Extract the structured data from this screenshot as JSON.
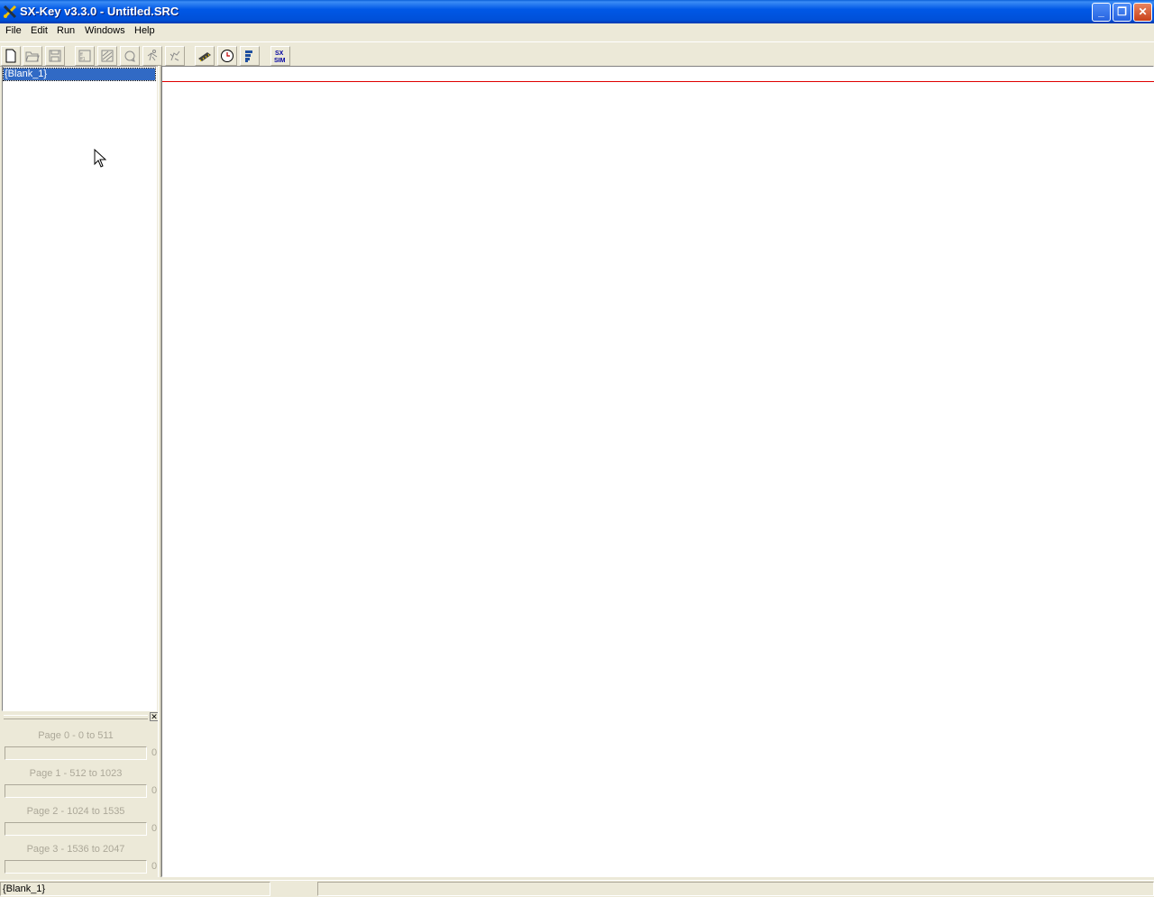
{
  "window": {
    "title": "SX-Key v3.3.0 - Untitled.SRC",
    "app_icon": "sx-key-tools-icon",
    "controls": {
      "minimize": "minimize-icon",
      "restore": "restore-icon",
      "close": "close-icon"
    }
  },
  "menubar": {
    "items": [
      {
        "label": "File"
      },
      {
        "label": "Edit"
      },
      {
        "label": "Run"
      },
      {
        "label": "Windows"
      },
      {
        "label": "Help"
      }
    ]
  },
  "toolbar": {
    "buttons": [
      {
        "name": "new-file",
        "icon": "new-document-icon"
      },
      {
        "name": "open-file",
        "icon": "open-folder-icon"
      },
      {
        "name": "save-file",
        "icon": "save-disk-icon"
      },
      {
        "name": "assemble",
        "icon": "assemble-icon"
      },
      {
        "name": "program",
        "icon": "program-icon"
      },
      {
        "name": "reset",
        "icon": "reset-icon"
      },
      {
        "name": "run",
        "icon": "run-icon"
      },
      {
        "name": "debug",
        "icon": "debug-icon"
      },
      {
        "name": "device",
        "icon": "chip-icon"
      },
      {
        "name": "clock",
        "icon": "clock-icon"
      },
      {
        "name": "list",
        "icon": "list-icon"
      },
      {
        "name": "sx-sim",
        "icon": "sx-sim-icon",
        "text": "SX SIM"
      }
    ]
  },
  "tree": {
    "selected_item": "{Blank_1}"
  },
  "memory_panel": {
    "pages": [
      {
        "label": "Page 0 - 0 to 511",
        "value": "0"
      },
      {
        "label": "Page 1 - 512 to 1023",
        "value": "0"
      },
      {
        "label": "Page 2 - 1024 to 1535",
        "value": "0"
      },
      {
        "label": "Page 3 - 1536 to 2047",
        "value": "0"
      }
    ]
  },
  "statusbar": {
    "panel1": "{Blank_1}",
    "panel2": "",
    "panel3": ""
  }
}
